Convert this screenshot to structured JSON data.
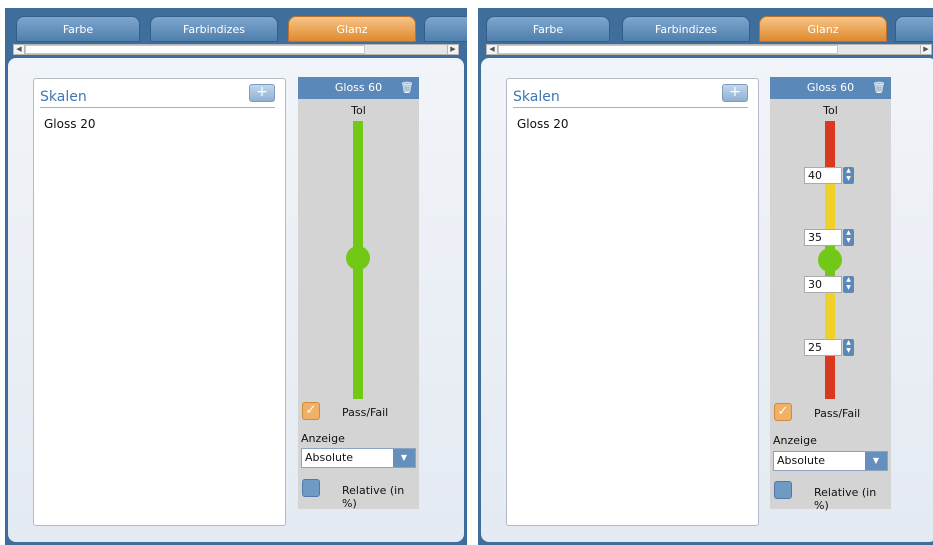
{
  "tabs": [
    "Farbe",
    "Farbindizes",
    "Glanz"
  ],
  "active_tab": "Glanz",
  "panels": [
    {
      "scales_title": "Skalen",
      "add_label": "+",
      "scale_items": [
        "Gloss 20"
      ],
      "gloss_title": "Gloss 60",
      "tol_label": "Tol",
      "pass_fail_label": "Pass/Fail",
      "pass_fail_checked": true,
      "anzeige_label": "Anzeige",
      "anzeige_value": "Absolute",
      "relative_label": "Relative (in %)",
      "relative_checked": false
    },
    {
      "scales_title": "Skalen",
      "add_label": "+",
      "scale_items": [
        "Gloss 20"
      ],
      "gloss_title": "Gloss 60",
      "tol_label": "Tol",
      "tolerance_values": [
        "40",
        "35",
        "30",
        "25"
      ],
      "pass_fail_label": "Pass/Fail",
      "pass_fail_checked": true,
      "anzeige_label": "Anzeige",
      "anzeige_value": "Absolute",
      "relative_label": "Relative (in %)",
      "relative_checked": false
    }
  ],
  "colors": {
    "active_tab": "#e0892d",
    "green": "#72c816",
    "yellow": "#f0d12b",
    "red": "#d9391f",
    "header_blue": "#5a88b9"
  },
  "icons": {
    "trash": "trash-icon",
    "dropdown": "chevron-down-icon",
    "check": "checkmark-icon"
  }
}
